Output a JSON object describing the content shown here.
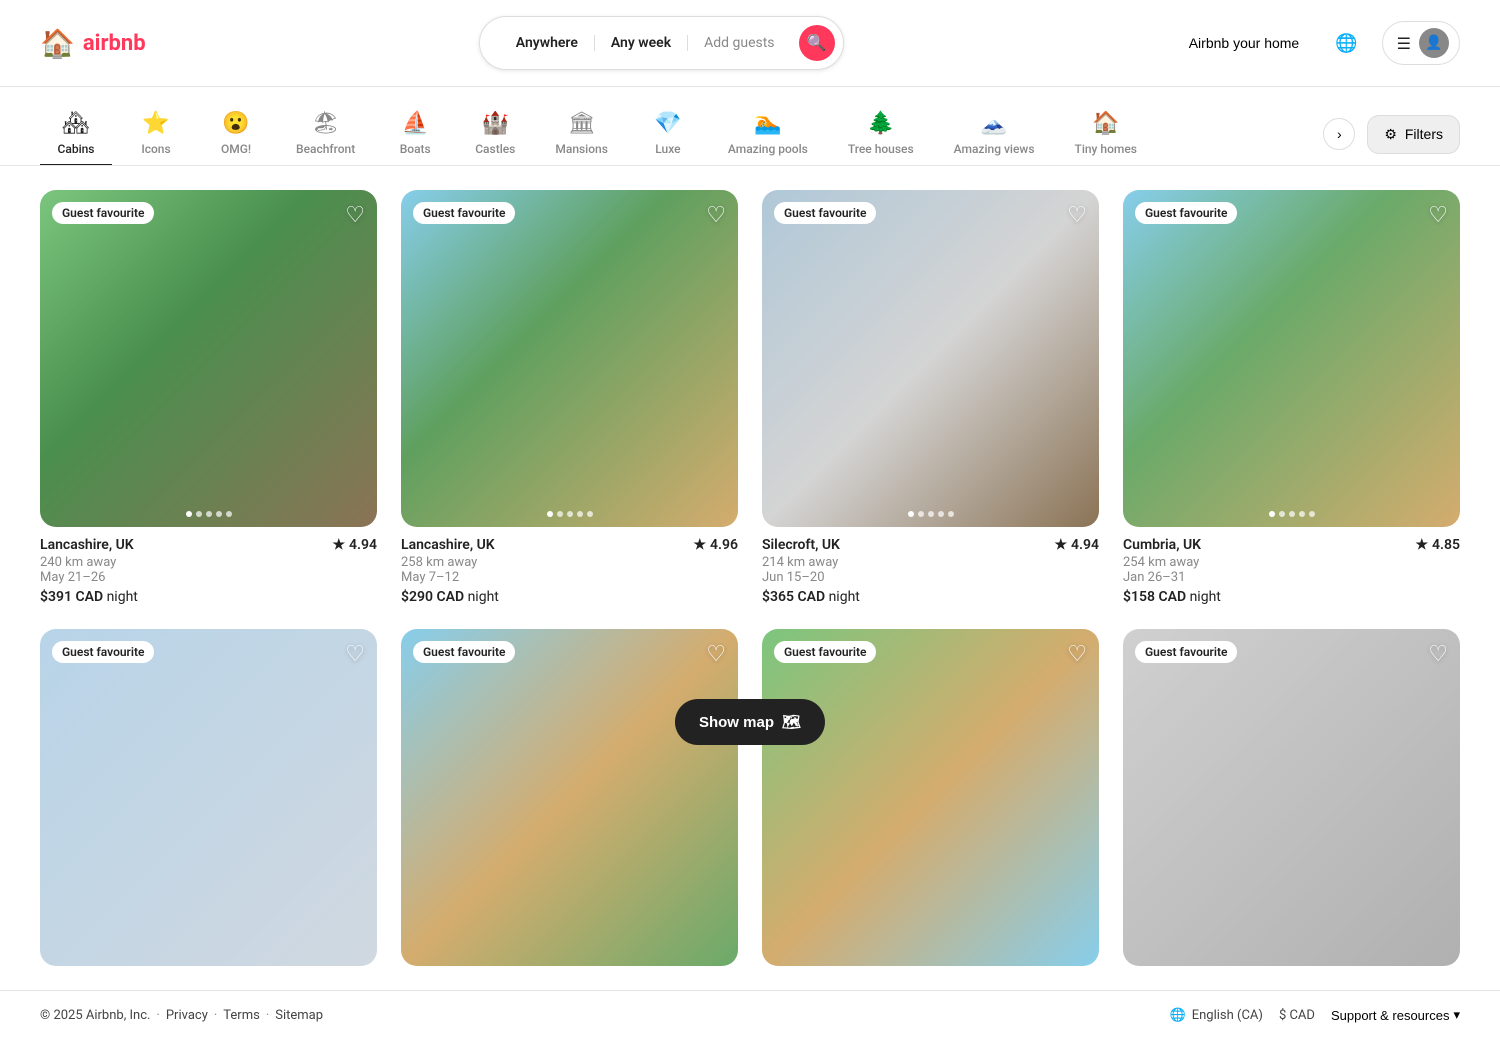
{
  "header": {
    "logo_icon": "🏠",
    "logo_text": "airbnb",
    "search": {
      "anywhere_label": "Anywhere",
      "any_week_label": "Any week",
      "add_guests_placeholder": "Add guests"
    },
    "airbnb_home_label": "Airbnb your home",
    "user_menu_aria": "User menu"
  },
  "categories": [
    {
      "id": "cabins",
      "icon": "🏘",
      "label": "Cabins",
      "active": true
    },
    {
      "id": "icons",
      "icon": "⭐",
      "label": "Icons",
      "active": false
    },
    {
      "id": "omg",
      "icon": "😮",
      "label": "OMG!",
      "active": false
    },
    {
      "id": "beachfront",
      "icon": "🏖",
      "label": "Beachfront",
      "active": false
    },
    {
      "id": "boats",
      "icon": "⛵",
      "label": "Boats",
      "active": false
    },
    {
      "id": "castles",
      "icon": "🏰",
      "label": "Castles",
      "active": false
    },
    {
      "id": "mansions",
      "icon": "🏛",
      "label": "Mansions",
      "active": false
    },
    {
      "id": "luxe",
      "icon": "💎",
      "label": "Luxe",
      "active": false
    },
    {
      "id": "amazing-pools",
      "icon": "🏊",
      "label": "Amazing pools",
      "active": false
    },
    {
      "id": "tree-houses",
      "icon": "🌲",
      "label": "Tree houses",
      "active": false
    },
    {
      "id": "amazing-views",
      "icon": "🗻",
      "label": "Amazing views",
      "active": false
    },
    {
      "id": "tiny-homes",
      "icon": "🏠",
      "label": "Tiny homes",
      "active": false
    }
  ],
  "filters_label": "Filters",
  "listings": [
    {
      "id": 1,
      "badge": "Guest favourite",
      "location": "Lancashire, UK",
      "rating": "4.94",
      "distance": "240 km away",
      "dates": "May 21–26",
      "price": "$391 CAD",
      "price_suffix": "night",
      "bg_class": "card-bg-1",
      "dots": 5,
      "active_dot": 0
    },
    {
      "id": 2,
      "badge": "Guest favourite",
      "location": "Lancashire, UK",
      "rating": "4.96",
      "distance": "258 km away",
      "dates": "May 7–12",
      "price": "$290 CAD",
      "price_suffix": "night",
      "bg_class": "card-bg-2",
      "dots": 5,
      "active_dot": 0
    },
    {
      "id": 3,
      "badge": "Guest favourite",
      "location": "Silecroft, UK",
      "rating": "4.94",
      "distance": "214 km away",
      "dates": "Jun 15–20",
      "price": "$365 CAD",
      "price_suffix": "night",
      "bg_class": "card-bg-3",
      "dots": 5,
      "active_dot": 0
    },
    {
      "id": 4,
      "badge": "Guest favourite",
      "location": "Cumbria, UK",
      "rating": "4.85",
      "distance": "254 km away",
      "dates": "Jan 26–31",
      "price": "$158 CAD",
      "price_suffix": "night",
      "bg_class": "card-bg-4",
      "dots": 5,
      "active_dot": 0
    },
    {
      "id": 5,
      "badge": "Guest favourite",
      "location": "",
      "rating": "",
      "distance": "",
      "dates": "",
      "price": "",
      "price_suffix": "",
      "bg_class": "card-bg-5",
      "dots": 0,
      "active_dot": 0
    },
    {
      "id": 6,
      "badge": "Guest favourite",
      "location": "",
      "rating": "",
      "distance": "",
      "dates": "",
      "price": "",
      "price_suffix": "",
      "bg_class": "card-bg-6",
      "dots": 0,
      "active_dot": 0
    },
    {
      "id": 7,
      "badge": "Guest favourite",
      "location": "",
      "rating": "",
      "distance": "",
      "dates": "",
      "price": "",
      "price_suffix": "",
      "bg_class": "card-bg-7",
      "dots": 0,
      "active_dot": 0
    },
    {
      "id": 8,
      "badge": "Guest favourite",
      "location": "",
      "rating": "",
      "distance": "",
      "dates": "",
      "price": "",
      "price_suffix": "",
      "bg_class": "card-bg-8",
      "dots": 0,
      "active_dot": 0
    }
  ],
  "show_map_label": "Show map",
  "show_map_icon": "🗺",
  "footer": {
    "copyright": "© 2025 Airbnb, Inc.",
    "privacy": "Privacy",
    "terms": "Terms",
    "sitemap": "Sitemap",
    "language": "English (CA)",
    "currency": "$ CAD",
    "support": "Support & resources",
    "chevron": "▾"
  }
}
